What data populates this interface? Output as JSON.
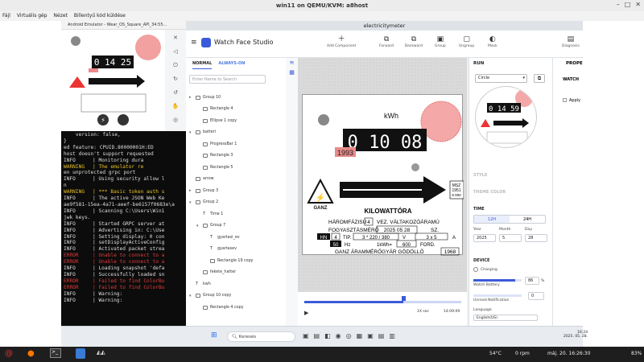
{
  "host": {
    "title": "win11 on QEMU/KVM: a8host",
    "menu": [
      "Fájl",
      "Virtuális gép",
      "Nézet",
      "Billentyű kód küldése"
    ]
  },
  "emulator": {
    "title": "Android Emulator - Wear_OS_Square_API_34:55...",
    "watch_time": "0 14 25"
  },
  "terminal": {
    "lines": [
      {
        "level": "",
        "text": "    version: false,"
      },
      {
        "level": "",
        "text": "}"
      },
      {
        "level": "",
        "text": "ed feature: CPUID.80000001H:ED"
      },
      {
        "level": "",
        "text": "host doesn't support requested"
      },
      {
        "level": "INFO",
        "text": "| Monitoring dura"
      },
      {
        "level": "WARNING",
        "text": "| The emulator re"
      },
      {
        "level": "",
        "text": "en unprotected grpc port"
      },
      {
        "level": "INFO",
        "text": "| Using security allow l"
      },
      {
        "level": "",
        "text": "n"
      },
      {
        "level": "WARNING",
        "text": "| *** Basic token auth s"
      },
      {
        "level": "INFO",
        "text": "| The active JSON Web Ke"
      },
      {
        "level": "",
        "text": "ae9f581-15ea-4a71-aeef-be6157f0683e\\a"
      },
      {
        "level": "INFO",
        "text": "| Scanning C:\\Users\\Win1"
      },
      {
        "level": "",
        "text": "jwk keys."
      },
      {
        "level": "INFO",
        "text": "| Started GRPC server at"
      },
      {
        "level": "INFO",
        "text": "| Advertising in: C:\\Use"
      },
      {
        "level": "INFO",
        "text": "| Setting display: 0 con"
      },
      {
        "level": "INFO",
        "text": "| setDisplayActiveConfig"
      },
      {
        "level": "INFO",
        "text": "| Activated packet strea"
      },
      {
        "level": "ERROR",
        "text": "| Unable to connect to a"
      },
      {
        "level": "ERROR",
        "text": "| Unable to connect to a"
      },
      {
        "level": "INFO",
        "text": "| Loading snapshot 'defa"
      },
      {
        "level": "INFO",
        "text": "| Successfully loaded sn"
      },
      {
        "level": "ERROR",
        "text": "| Failed to find ColorBu"
      },
      {
        "level": "ERROR",
        "text": "| Failed to find ColorBu"
      },
      {
        "level": "INFO",
        "text": "| Warning:"
      },
      {
        "level": "INFO",
        "text": "| Warning:"
      }
    ]
  },
  "app": {
    "tab_title": "electricitymeter",
    "name": "Watch Face Studio",
    "toolbar": {
      "add_component": "Add Component",
      "forward": "Forward",
      "backward": "Backward",
      "group": "Group",
      "ungroup": "Ungroup",
      "mask": "Mask",
      "diagnosis": "Diagnosis"
    }
  },
  "layers": {
    "tab_normal": "NORMAL",
    "tab_always_on": "ALWAYS-ON",
    "search_placeholder": "Enter Name to Search",
    "items": [
      {
        "indent": 0,
        "expand": "▸",
        "label": "Group 10",
        "kind": "group"
      },
      {
        "indent": 1,
        "expand": "",
        "label": "Rectangle 4",
        "kind": "rect"
      },
      {
        "indent": 1,
        "expand": "",
        "label": "Ellipse 1 copy",
        "kind": "rect"
      },
      {
        "indent": 0,
        "expand": "▾",
        "label": "batteri",
        "kind": "group"
      },
      {
        "indent": 1,
        "expand": "",
        "label": "ProgressBar 1",
        "kind": "rect"
      },
      {
        "indent": 1,
        "expand": "",
        "label": "Rectangle 3",
        "kind": "rect"
      },
      {
        "indent": 1,
        "expand": "",
        "label": "Rectangle 5",
        "kind": "rect"
      },
      {
        "indent": 0,
        "expand": "",
        "label": "arrow",
        "kind": "image"
      },
      {
        "indent": 0,
        "expand": "▸",
        "label": "Group 3",
        "kind": "group"
      },
      {
        "indent": 0,
        "expand": "▾",
        "label": "Group 2",
        "kind": "group"
      },
      {
        "indent": 1,
        "expand": "",
        "label": "Time 1",
        "kind": "time"
      },
      {
        "indent": 1,
        "expand": "▾",
        "label": "Group 7",
        "kind": "group"
      },
      {
        "indent": 2,
        "expand": "",
        "label": "gyartasi_ev",
        "kind": "text"
      },
      {
        "indent": 2,
        "expand": "",
        "label": "gyartasev",
        "kind": "text"
      },
      {
        "indent": 2,
        "expand": "",
        "label": "Rectangle 19 copy",
        "kind": "rect"
      },
      {
        "indent": 1,
        "expand": "",
        "label": "fekete_hatter",
        "kind": "rect"
      },
      {
        "indent": 0,
        "expand": "",
        "label": "kwh",
        "kind": "text"
      },
      {
        "indent": 0,
        "expand": "▾",
        "label": "Group 10 copy",
        "kind": "group"
      },
      {
        "indent": 1,
        "expand": "",
        "label": "Rectangle 4 copy",
        "kind": "rect"
      }
    ]
  },
  "meter": {
    "kwh_label": "kWh",
    "counter": "0 10 08",
    "year_tag": "1993",
    "brand": "GANZ",
    "kilowattora": "KILOWATTÓRA",
    "mszi": "MSZ\n1951\n8 000",
    "row1": "HÁROMFÁZISÚ",
    "row1_val": "4",
    "row1_b": "VEZ. VÁLTAKOZÓÁRAMÚ",
    "row2": "FOGYASZTÁSMÉRŐ",
    "row2_date": "2025 05 28",
    "row2_b": "SZ.",
    "row3_hn": "HN",
    "row3_4": "4",
    "row3_tip": "TIP.",
    "row3_volt": "3 * 220 / 380",
    "row3_v": "V",
    "row3_amp": "3 x 5",
    "row3_a": "A",
    "row4_50": "50",
    "row4_hz": "Hz",
    "row4_kwh": "1kWh=",
    "row4_600": "600",
    "row4_ford": "FORD.",
    "footer": "GANZ ÁRAMMÉRŐGYÁR GÖDÖLLŐ",
    "footer_year": "1968"
  },
  "timeline": {
    "play": "▶",
    "speed": "1X sec",
    "time": "14:09:09",
    "progress": 0.63
  },
  "run": {
    "label": "RUN",
    "shape": "Circle",
    "preview_time": "0 14 59",
    "style": "STYLE",
    "theme_color": "THEME COLOR",
    "time_section": "TIME",
    "h12": "12H",
    "h24": "24H",
    "year_label": "Year",
    "month_label": "Month",
    "day_label": "Day",
    "year": "2025",
    "month": "5",
    "day": "28",
    "device": "DEVICE",
    "charging": "Charging",
    "watch_battery": "Watch Battery",
    "battery_pct": "86",
    "battery_unit": "%",
    "unread": "Unread Notification",
    "unread_count": "0",
    "language": "Language",
    "language_value": "English(US)"
  },
  "props": {
    "label": "PROPE",
    "watch": "WATCH",
    "apply": "Apply"
  },
  "vm_taskbar": {
    "search": "Keresés",
    "clock_time": "16:24",
    "clock_date": "2025. 05. 28."
  },
  "linux": {
    "temp": "54°C",
    "fan": "0 rpm",
    "datetime": "máj. 20. 16:26:30",
    "battery": "83%"
  },
  "colors": {
    "accent": "#3a5bd9",
    "error": "#e03b3b",
    "warning": "#e5c027"
  }
}
